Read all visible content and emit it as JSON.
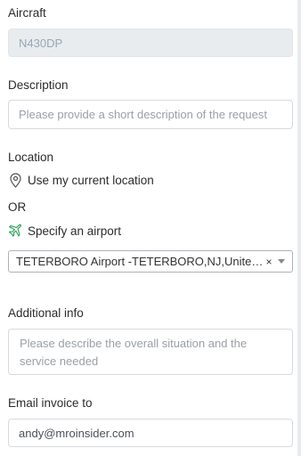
{
  "aircraft": {
    "label": "Aircraft",
    "value": "N430DP"
  },
  "description": {
    "label": "Description",
    "placeholder": "Please provide a short description of the request"
  },
  "location": {
    "label": "Location",
    "current_location_label": "Use my current location",
    "current_location_icon": "map-pin-icon",
    "or_text": "OR",
    "specify_airport_label": "Specify an airport",
    "airport_icon": "airplane-icon",
    "airport_select": {
      "value": "TETERBORO Airport -TETERBORO,NJ,United States",
      "clear": "×"
    }
  },
  "additional_info": {
    "label": "Additional info",
    "placeholder": "Please describe the overall situation and the service needed"
  },
  "email_invoice": {
    "label": "Email invoice to",
    "value": "andy@mroinsider.com"
  },
  "colors": {
    "airplane_icon": "#2e9e5b",
    "disabled_bg": "#e9ecef"
  }
}
